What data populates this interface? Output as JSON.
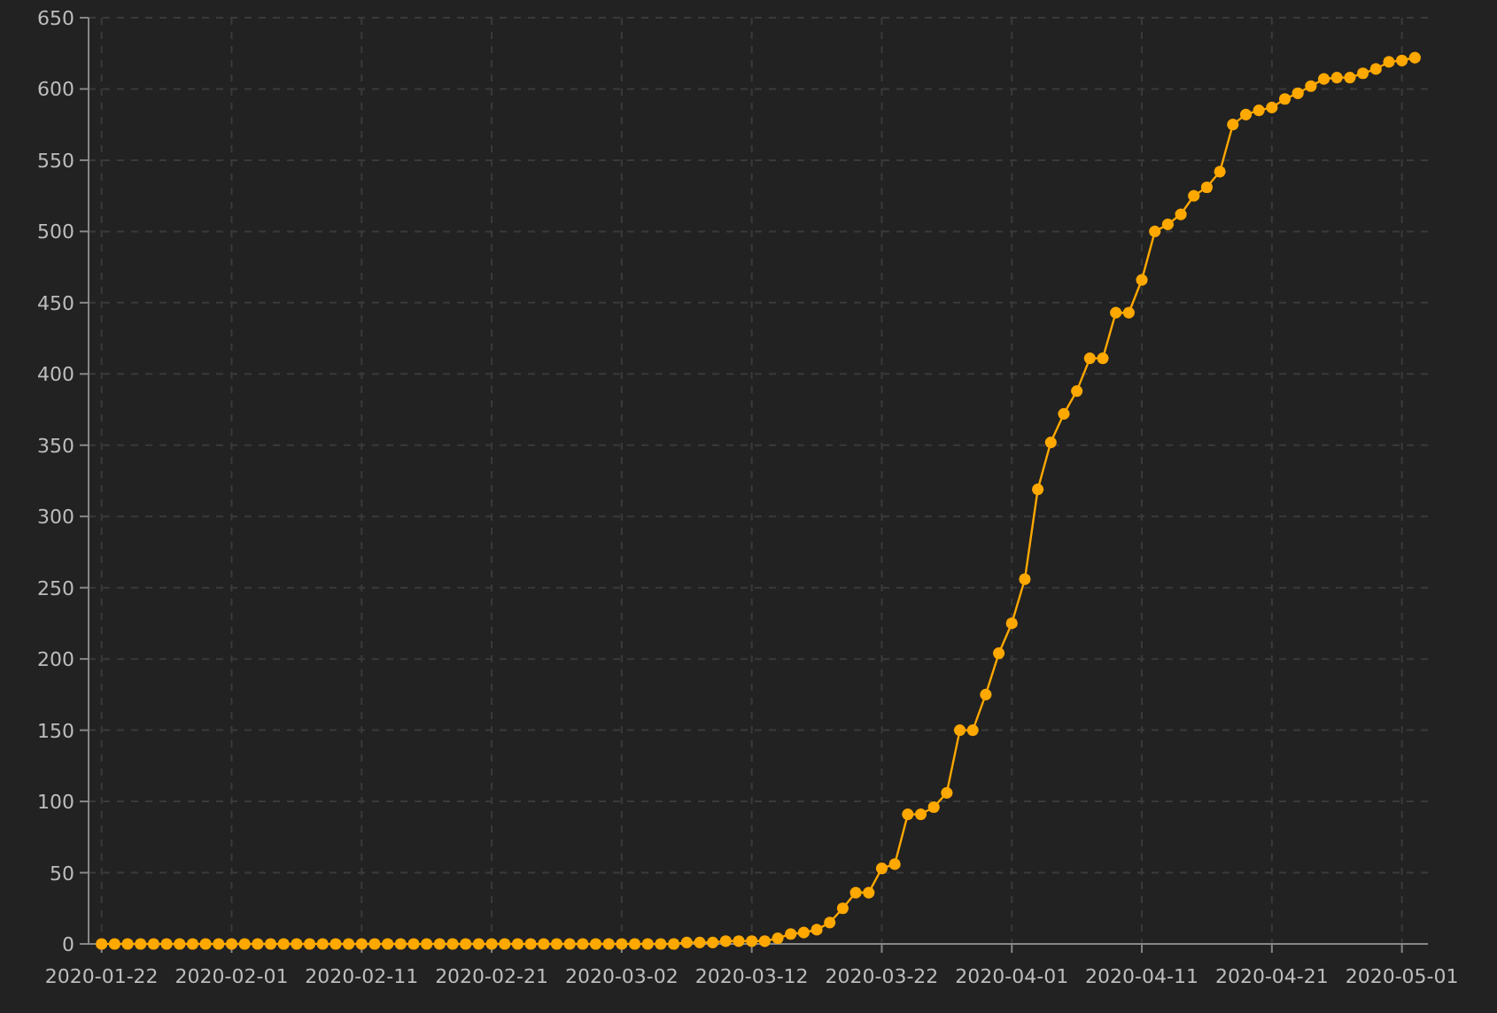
{
  "chart": {
    "chart_data": {
      "type": "line",
      "grid": true,
      "x": [
        "2020-01-22",
        "2020-01-23",
        "2020-01-24",
        "2020-01-25",
        "2020-01-26",
        "2020-01-27",
        "2020-01-28",
        "2020-01-29",
        "2020-01-30",
        "2020-01-31",
        "2020-02-01",
        "2020-02-02",
        "2020-02-03",
        "2020-02-04",
        "2020-02-05",
        "2020-02-06",
        "2020-02-07",
        "2020-02-08",
        "2020-02-09",
        "2020-02-10",
        "2020-02-11",
        "2020-02-12",
        "2020-02-13",
        "2020-02-14",
        "2020-02-15",
        "2020-02-16",
        "2020-02-17",
        "2020-02-18",
        "2020-02-19",
        "2020-02-20",
        "2020-02-21",
        "2020-02-22",
        "2020-02-23",
        "2020-02-24",
        "2020-02-25",
        "2020-02-26",
        "2020-02-27",
        "2020-02-28",
        "2020-02-29",
        "2020-03-01",
        "2020-03-02",
        "2020-03-03",
        "2020-03-04",
        "2020-03-05",
        "2020-03-06",
        "2020-03-07",
        "2020-03-08",
        "2020-03-09",
        "2020-03-10",
        "2020-03-11",
        "2020-03-12",
        "2020-03-13",
        "2020-03-14",
        "2020-03-15",
        "2020-03-16",
        "2020-03-17",
        "2020-03-18",
        "2020-03-19",
        "2020-03-20",
        "2020-03-21",
        "2020-03-22",
        "2020-03-23",
        "2020-03-24",
        "2020-03-25",
        "2020-03-26",
        "2020-03-27",
        "2020-03-28",
        "2020-03-29",
        "2020-03-30",
        "2020-03-31",
        "2020-04-01",
        "2020-04-02",
        "2020-04-03",
        "2020-04-04",
        "2020-04-05",
        "2020-04-06",
        "2020-04-07",
        "2020-04-08",
        "2020-04-09",
        "2020-04-10",
        "2020-04-11",
        "2020-04-12",
        "2020-04-13",
        "2020-04-14",
        "2020-04-15",
        "2020-04-16",
        "2020-04-17",
        "2020-04-18",
        "2020-04-19",
        "2020-04-20",
        "2020-04-21",
        "2020-04-22",
        "2020-04-23",
        "2020-04-24",
        "2020-04-25",
        "2020-04-26",
        "2020-04-27",
        "2020-04-28",
        "2020-04-29",
        "2020-04-30",
        "2020-05-01",
        "2020-05-02"
      ],
      "series": [
        {
          "color": "#ffa800",
          "marker": "circle",
          "values": [
            0,
            0,
            0,
            0,
            0,
            0,
            0,
            0,
            0,
            0,
            0,
            0,
            0,
            0,
            0,
            0,
            0,
            0,
            0,
            0,
            0,
            0,
            0,
            0,
            0,
            0,
            0,
            0,
            0,
            0,
            0,
            0,
            0,
            0,
            0,
            0,
            0,
            0,
            0,
            0,
            0,
            0,
            0,
            0,
            0,
            1,
            1,
            1,
            2,
            2,
            2,
            2,
            4,
            7,
            8,
            10,
            15,
            25,
            36,
            36,
            53,
            56,
            91,
            91,
            96,
            106,
            150,
            150,
            175,
            204,
            225,
            256,
            319,
            352,
            372,
            388,
            411,
            411,
            443,
            443,
            466,
            500,
            505,
            512,
            525,
            531,
            542,
            575,
            582,
            585,
            587,
            593,
            597,
            602,
            607,
            608,
            608,
            611,
            614,
            619,
            620,
            622
          ]
        }
      ],
      "xlim": [
        "2020-01-21",
        "2020-05-03"
      ],
      "ylim": [
        0,
        650
      ],
      "yticks": [
        0,
        50,
        100,
        150,
        200,
        250,
        300,
        350,
        400,
        450,
        500,
        550,
        600,
        650
      ],
      "xticks": [
        "2020-01-22",
        "2020-02-01",
        "2020-02-11",
        "2020-02-21",
        "2020-03-02",
        "2020-03-12",
        "2020-03-22",
        "2020-04-01",
        "2020-04-11",
        "2020-04-21",
        "2020-05-01"
      ]
    }
  }
}
